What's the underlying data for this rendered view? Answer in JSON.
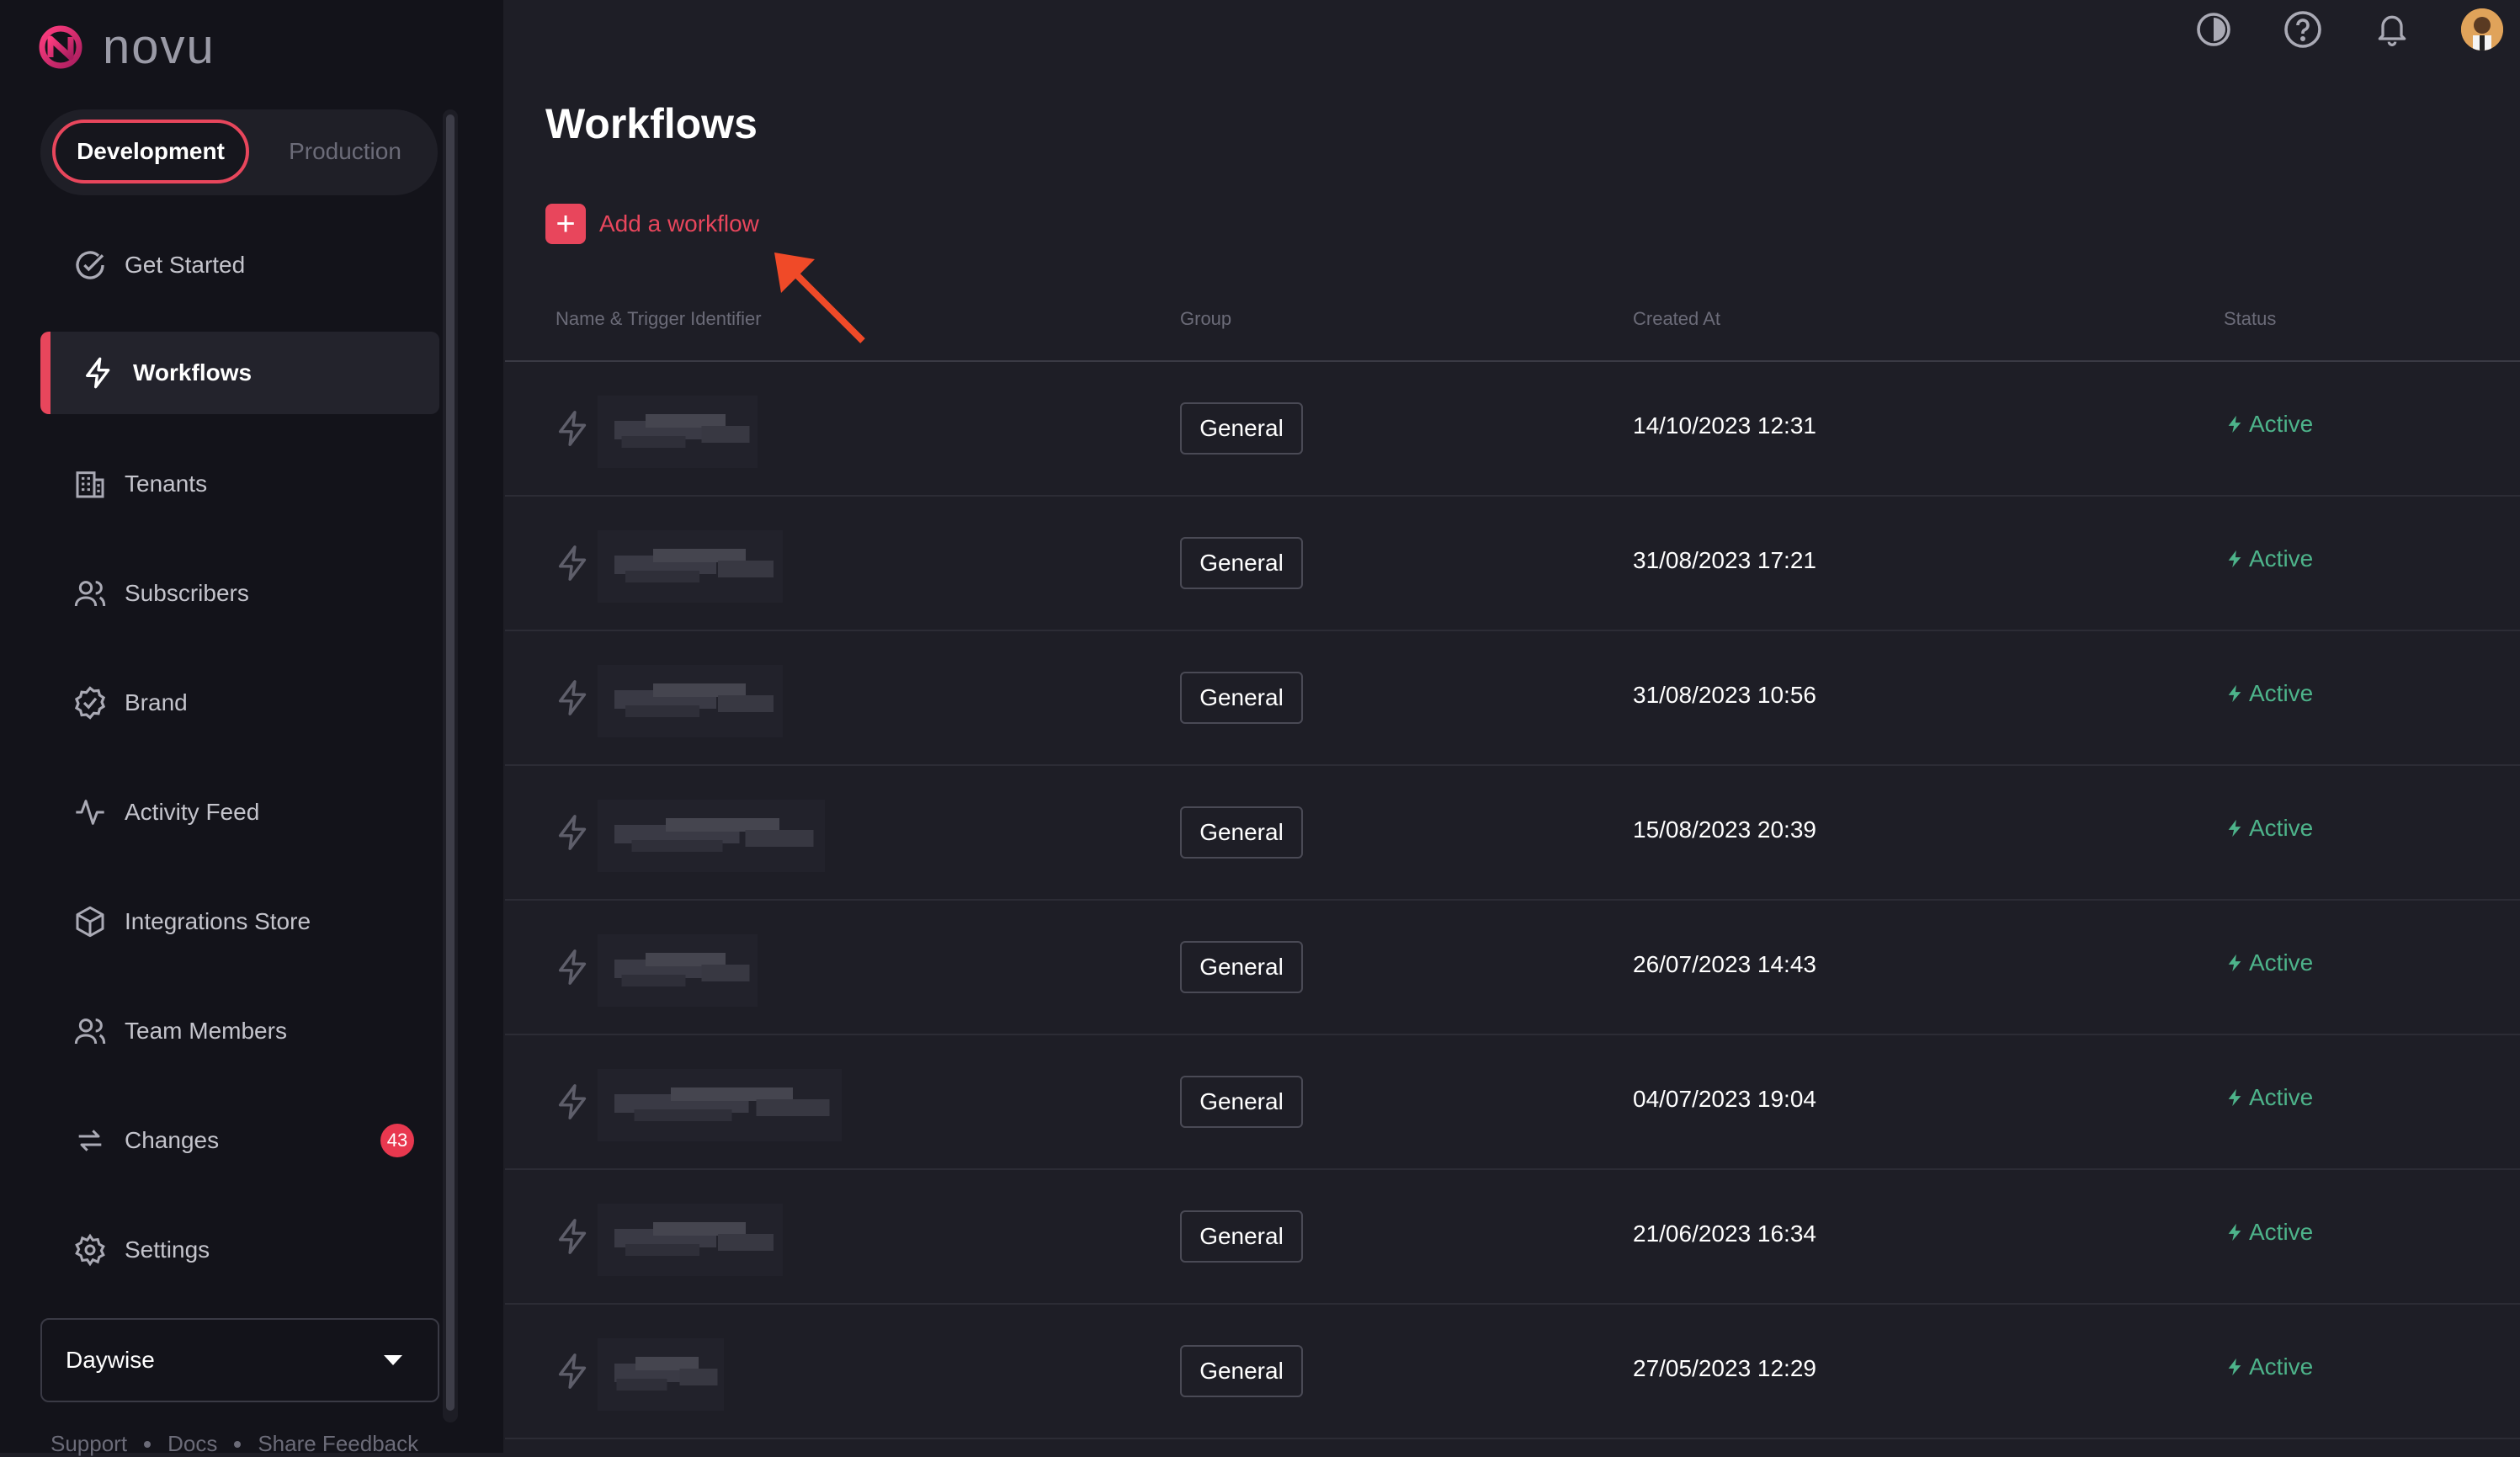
{
  "app": {
    "name": "novu"
  },
  "environment": {
    "dev_label": "Development",
    "prod_label": "Production"
  },
  "sidebar": {
    "items": [
      {
        "label": "Get Started",
        "icon": "check-circle-icon"
      },
      {
        "label": "Workflows",
        "icon": "bolt-icon",
        "active": true
      },
      {
        "label": "Tenants",
        "icon": "building-icon"
      },
      {
        "label": "Subscribers",
        "icon": "users-icon"
      },
      {
        "label": "Brand",
        "icon": "badge-check-icon"
      },
      {
        "label": "Activity Feed",
        "icon": "activity-icon"
      },
      {
        "label": "Integrations Store",
        "icon": "box-icon"
      },
      {
        "label": "Team Members",
        "icon": "team-icon"
      },
      {
        "label": "Changes",
        "icon": "sync-icon",
        "badge": "43"
      },
      {
        "label": "Settings",
        "icon": "gear-icon"
      }
    ],
    "org": "Daywise",
    "footer": [
      "Support",
      "Docs",
      "Share Feedback"
    ]
  },
  "main": {
    "title": "Workflows",
    "add_label": "Add a workflow",
    "columns": [
      "Name & Trigger Identifier",
      "Group",
      "Created At",
      "Status"
    ],
    "rows": [
      {
        "group": "General",
        "created": "14/10/2023 12:31",
        "status": "Active"
      },
      {
        "group": "General",
        "created": "31/08/2023 17:21",
        "status": "Active"
      },
      {
        "group": "General",
        "created": "31/08/2023 10:56",
        "status": "Active"
      },
      {
        "group": "General",
        "created": "15/08/2023 20:39",
        "status": "Active"
      },
      {
        "group": "General",
        "created": "26/07/2023 14:43",
        "status": "Active"
      },
      {
        "group": "General",
        "created": "04/07/2023 19:04",
        "status": "Active"
      },
      {
        "group": "General",
        "created": "21/06/2023 16:34",
        "status": "Active"
      },
      {
        "group": "General",
        "created": "27/05/2023 12:29",
        "status": "Active"
      }
    ]
  },
  "colors": {
    "accent": "#e8465c",
    "active_status": "#4db38a"
  }
}
